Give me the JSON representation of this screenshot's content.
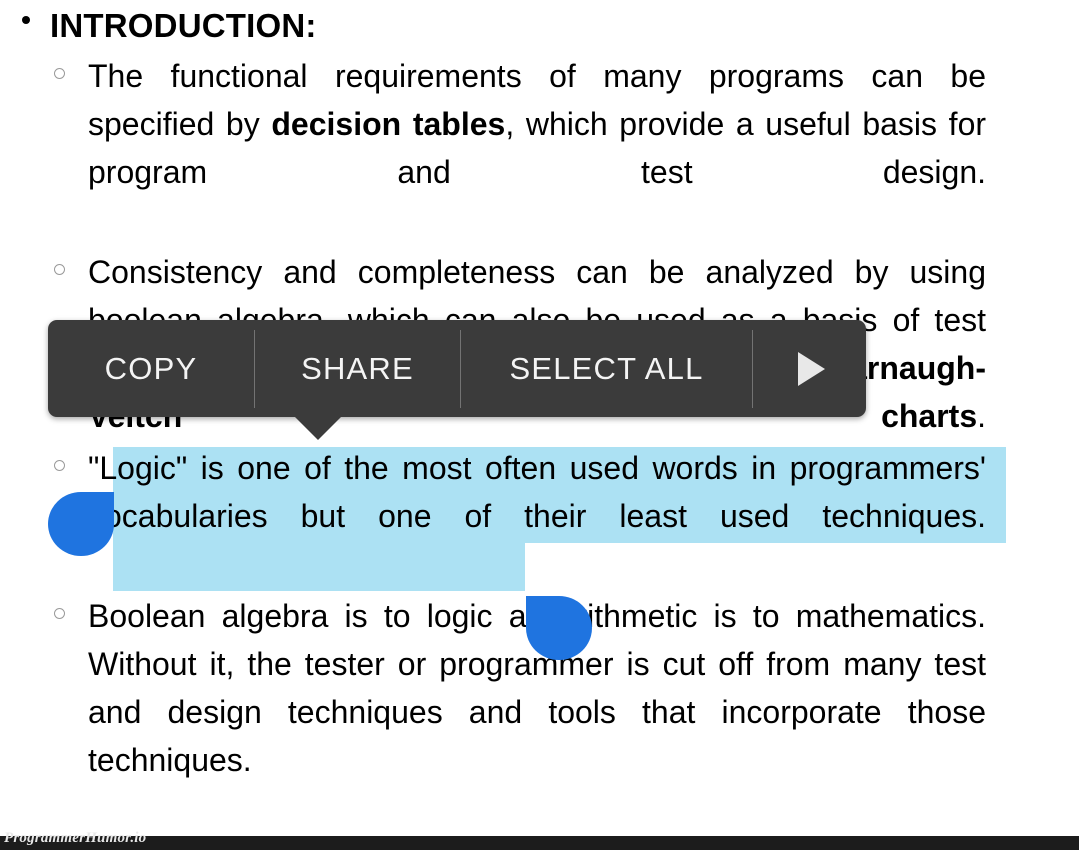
{
  "slide": {
    "heading": {
      "text": "INTRODUCTION:",
      "bullet": "filled-disc"
    },
    "bullets": [
      {
        "id": "b1",
        "bullet": "hollow-circle",
        "text_before_bold": "The functional requirements of many programs can be specified by ",
        "bold": "decision tables",
        "text_after_bold": ", which provide a useful basis for program and test design."
      },
      {
        "id": "b2",
        "bullet": "hollow-circle",
        "text_before_bold": "Consistency and completeness can be analyzed by using boolean algebra, which can also be used as a basis of test design. Boolean algebra is trivialized by using ",
        "bold": "Karnaugh-Veitch charts",
        "text_after_bold": "."
      },
      {
        "id": "b3",
        "bullet": "hollow-circle",
        "text_before_bold": "\"Logic\" is one of the most often used words in programmers' vocabularies but one of their least used techniques.",
        "bold": "",
        "text_after_bold": "",
        "selected": true
      },
      {
        "id": "b4",
        "bullet": "hollow-circle",
        "text_before_bold": "Boolean algebra is to logic as arithmetic is to mathematics. Without it, the tester or programmer is cut off from many test and design techniques and tools that incorporate those techniques.",
        "bold": "",
        "text_after_bold": ""
      }
    ]
  },
  "context_menu": {
    "items": [
      {
        "id": "copy",
        "label": "COPY",
        "icon": ""
      },
      {
        "id": "share",
        "label": "SHARE",
        "icon": ""
      },
      {
        "id": "select_all",
        "label": "SELECT ALL",
        "icon": ""
      },
      {
        "id": "overflow",
        "label": "",
        "icon": "play-triangle-icon"
      }
    ]
  },
  "selection": {
    "selected_text": "\"Logic\" is one of the most often used words in programmers' vocabularies but one of their least used techniques.",
    "handles": [
      "selection-start-handle",
      "selection-end-handle"
    ]
  },
  "colors": {
    "selection_highlight": "#ace1f3",
    "selection_handle": "#1f74e0",
    "menu_background": "#3b3b3b",
    "menu_text": "#f4f4f4",
    "page_edge_green": "#3f8a5e",
    "page_edge_cream": "#fbfbe0",
    "watermark_bar": "#1c1c1c",
    "body_text": "#000000"
  },
  "watermark": {
    "text": "ProgrammerHumor.io"
  }
}
